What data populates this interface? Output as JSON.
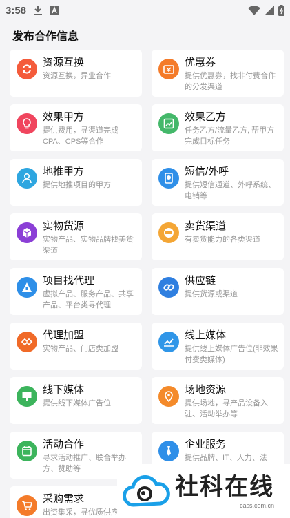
{
  "status_bar": {
    "time": "3:58"
  },
  "page_title": "发布合作信息",
  "items": [
    {
      "title": "资源互换",
      "desc": "资源互换，异业合作",
      "icon": "exchange-icon",
      "color": "#f45b3b"
    },
    {
      "title": "优惠券",
      "desc": "提供优惠券，找非付费合作的分发渠道",
      "icon": "coupon-icon",
      "color": "#f47b2a"
    },
    {
      "title": "效果甲方",
      "desc": "提供费用，寻渠道完成CPA、CPS等合作",
      "icon": "lightbulb-icon",
      "color": "#f0455e"
    },
    {
      "title": "效果乙方",
      "desc": "任务乙方/流量乙方, 帮甲方完成目标任务",
      "icon": "chart-card-icon",
      "color": "#44b86a"
    },
    {
      "title": "地推甲方",
      "desc": "提供地推项目的甲方",
      "icon": "person-icon",
      "color": "#2ea6e0"
    },
    {
      "title": "短信/外呼",
      "desc": "提供短信通道、外呼系统、电销等",
      "icon": "phone-chat-icon",
      "color": "#2f8fe8"
    },
    {
      "title": "实物货源",
      "desc": "实物产品、实物品牌找美货渠道",
      "icon": "cube-icon",
      "color": "#8b3fd6"
    },
    {
      "title": "卖货渠道",
      "desc": "有卖货能力的各类渠道",
      "icon": "sale-tag-icon",
      "color": "#f4a635"
    },
    {
      "title": "项目找代理",
      "desc": "虚拟产品、服务产品、共享产品、平台类寻代理",
      "icon": "agent-icon",
      "color": "#2e8fe8"
    },
    {
      "title": "供应链",
      "desc": "提供货源或渠道",
      "icon": "link-icon",
      "color": "#2f7fe0"
    },
    {
      "title": "代理加盟",
      "desc": "实物产品、门店类加盟",
      "icon": "handshake-icon",
      "color": "#f06a28"
    },
    {
      "title": "线上媒体",
      "desc": "提供线上媒体广告位(非效果付费类媒体)",
      "icon": "line-chart-icon",
      "color": "#3096e8"
    },
    {
      "title": "线下媒体",
      "desc": "提供线下媒体广告位",
      "icon": "billboard-icon",
      "color": "#3cb45c"
    },
    {
      "title": "场地资源",
      "desc": "提供场地，寻产品设备入驻、活动举办等",
      "icon": "location-icon",
      "color": "#f48a2a"
    },
    {
      "title": "活动合作",
      "desc": "寻求活动推广、联合举办方、赞助等",
      "icon": "calendar-icon",
      "color": "#3cb45c"
    },
    {
      "title": "企业服务",
      "desc": "提供品牌、IT、人力、法",
      "icon": "tie-icon",
      "color": "#2f8fe8"
    },
    {
      "title": "采购需求",
      "desc": "出资集采，寻优质供应",
      "icon": "cart-icon",
      "color": "#f47b2a"
    }
  ],
  "watermark": {
    "brand": "社科在线",
    "url": "cass.com.cn"
  }
}
